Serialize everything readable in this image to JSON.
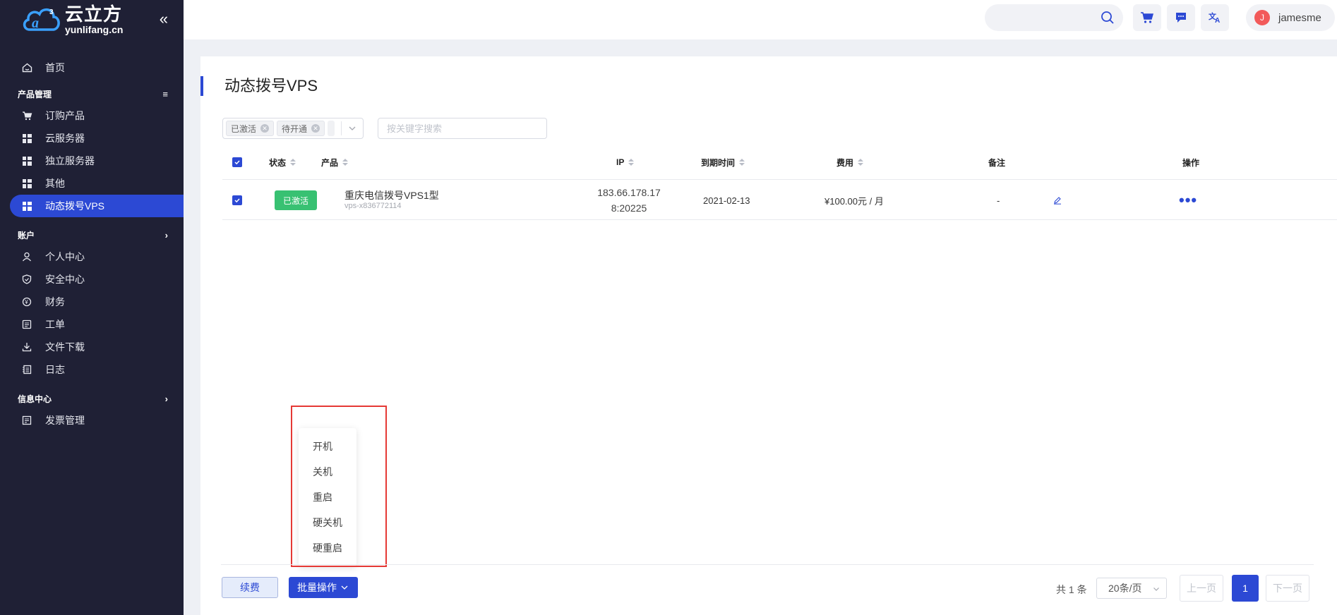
{
  "brand": {
    "name_cn": "云立方",
    "name_en": "yunlifang.cn"
  },
  "sidebar": {
    "home": "首页",
    "product_group": "产品管理",
    "product_items": [
      "订购产品",
      "云服务器",
      "独立服务器",
      "其他",
      "动态拨号VPS"
    ],
    "account_group": "账户",
    "account_items": [
      "个人中心",
      "安全中心",
      "财务",
      "工单",
      "文件下载",
      "日志"
    ],
    "info_group": "信息中心",
    "info_items": [
      "发票管理"
    ]
  },
  "topbar": {
    "search_value": "",
    "username": "jamesme",
    "avatar_letter": "J"
  },
  "page": {
    "title": "动态拨号VPS"
  },
  "filter": {
    "tags": [
      "已激活",
      "待开通"
    ],
    "keyword_placeholder": "按关键字搜索"
  },
  "table": {
    "headers": {
      "status": "状态",
      "product": "产品",
      "ip": "IP",
      "expire": "到期时间",
      "fee": "费用",
      "note": "备注",
      "action": "操作"
    },
    "rows": [
      {
        "status": "已激活",
        "product_name": "重庆电信拨号VPS1型",
        "product_code": "vps-x836772114",
        "ip_line1": "183.66.178.17",
        "ip_line2": "8:20225",
        "expire": "2021-02-13",
        "fee": "¥100.00元 / 月",
        "note": "-",
        "more": "•••"
      }
    ]
  },
  "batch_menu": [
    "开机",
    "关机",
    "重启",
    "硬关机",
    "硬重启"
  ],
  "footer": {
    "renew": "续费",
    "batch": "批量操作",
    "total": "共 1 条",
    "page_size": "20条/页",
    "prev": "上一页",
    "current_page": "1",
    "next": "下一页"
  },
  "colors": {
    "sidebar_bg": "#1f2035",
    "accent": "#2c49d4",
    "success": "#38c172",
    "highlight": "#e53935"
  }
}
